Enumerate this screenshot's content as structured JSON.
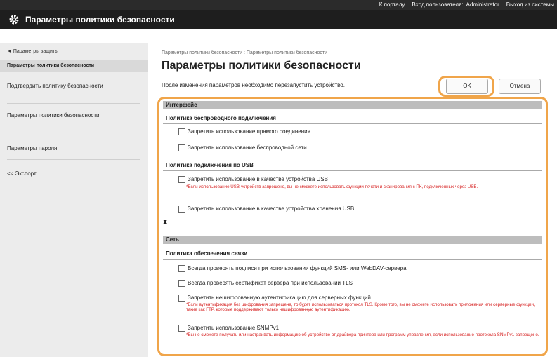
{
  "topbar": {
    "portal": "К порталу",
    "user_label": "Вход пользователя:",
    "user_name": "Administrator",
    "logout": "Выход из системы"
  },
  "app": {
    "title": "Параметры политики безопасности",
    "icon": "gear-icon"
  },
  "sidebar": {
    "back": "◄ Параметры защиты",
    "header": "Параметры политики безопасности",
    "items": [
      {
        "label": "Подтвердить политику безопасности"
      },
      {
        "label": "Параметры политики безопасности"
      },
      {
        "label": "Параметры пароля"
      },
      {
        "label": "<< Экспорт"
      }
    ]
  },
  "main": {
    "breadcrumb": "Параметры политики безопасности : Параметры политики безопасности",
    "title": "Параметры политики безопасности",
    "notice": "После изменения параметров необходимо перезапустить устройство.",
    "ok_label": "OK",
    "cancel_label": "Отмена",
    "collapse_glyph": "⧗"
  },
  "sections": {
    "interface": {
      "title": "Интерфейс",
      "wireless_group": "Политика беспроводного подключения",
      "wireless_opts": [
        "Запретить использование прямого соединения",
        "Запретить использование беспроводной сети"
      ],
      "usb_group": "Политика подключения по USB",
      "usb_opt1": "Запретить использование в качестве устройства USB",
      "usb_note": "*Если использование USB-устройств запрещено, вы не сможете использовать функции печати и сканирования с ПК, подключенных через USB.",
      "usb_opt2": "Запретить использование в качестве устройства хранения USB"
    },
    "network": {
      "title": "Сеть",
      "comm_group": "Политика обеспечения связи",
      "opt1": "Всегда проверять подписи при использовании функций SMS- или WebDAV-сервера",
      "opt2": "Всегда проверять сертификат сервера при использовании TLS",
      "opt3": "Запретить нешифрованную аутентификацию для серверных функций",
      "note3": "*Если аутентификация без шифрования запрещена, то будет использоваться протокол TLS. Кроме того, вы не сможете использовать приложения или серверные функции, такие как FTP, которые поддерживают только нешифрованную аутентификацию.",
      "opt4": "Запретить использование SNMPv1",
      "note4": "*Вы не сможете получать или настраивать информацию об устройстве от драйвера принтера или программ управления, если использование протокола SNMPv1 запрещено."
    }
  },
  "colors": {
    "highlight": "#f0a54a",
    "note": "#d62020",
    "section": "#bdbdbd"
  }
}
